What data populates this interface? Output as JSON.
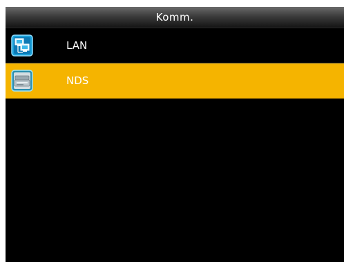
{
  "header": {
    "title": "Komm."
  },
  "menu": {
    "items": [
      {
        "label": "LAN",
        "icon": "network-computers-icon",
        "selected": false
      },
      {
        "label": "NDS",
        "icon": "nds-device-icon",
        "selected": true
      }
    ]
  },
  "colors": {
    "background": "#000000",
    "selection": "#f5b400",
    "text": "#ffffff"
  }
}
